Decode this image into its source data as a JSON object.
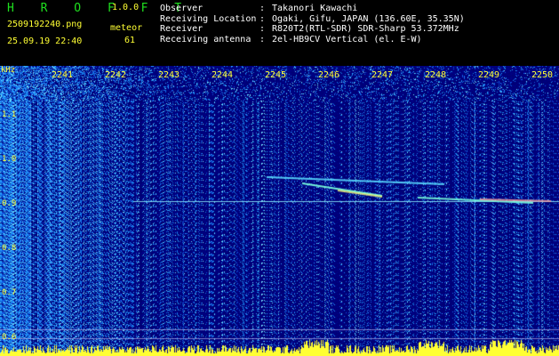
{
  "header": {
    "app_title": "H R O F F T",
    "version": "1.0.0",
    "filename": "2509192240.png",
    "datetime": "25.09.19 22:40",
    "detection_label": "meteor",
    "detection_count": "61",
    "info": [
      {
        "key": "Observer",
        "value": "Takanori Kawachi"
      },
      {
        "key": "Receiving Location",
        "value": "Ogaki, Gifu, JAPAN (136.60E, 35.35N)"
      },
      {
        "key": "Receiver",
        "value": "R820T2(RTL-SDR) SDR-Sharp 53.372MHz"
      },
      {
        "key": "Receiving antenna",
        "value": "2el-HB9CV Vertical (el. E-W)"
      }
    ]
  },
  "spectrogram": {
    "unit_label": "kHz",
    "time_ticks": [
      "2241",
      "2242",
      "2243",
      "2244",
      "2245",
      "2246",
      "2247",
      "2248",
      "2249",
      "2250"
    ],
    "freq_ticks": [
      "1.1",
      "1.0",
      "0.9",
      "0.8",
      "0.7",
      "0.6"
    ],
    "colors": {
      "background": "#00008b",
      "noise": "#2a6cff",
      "hot": "#00ffee",
      "tick": "#ffff33"
    }
  }
}
